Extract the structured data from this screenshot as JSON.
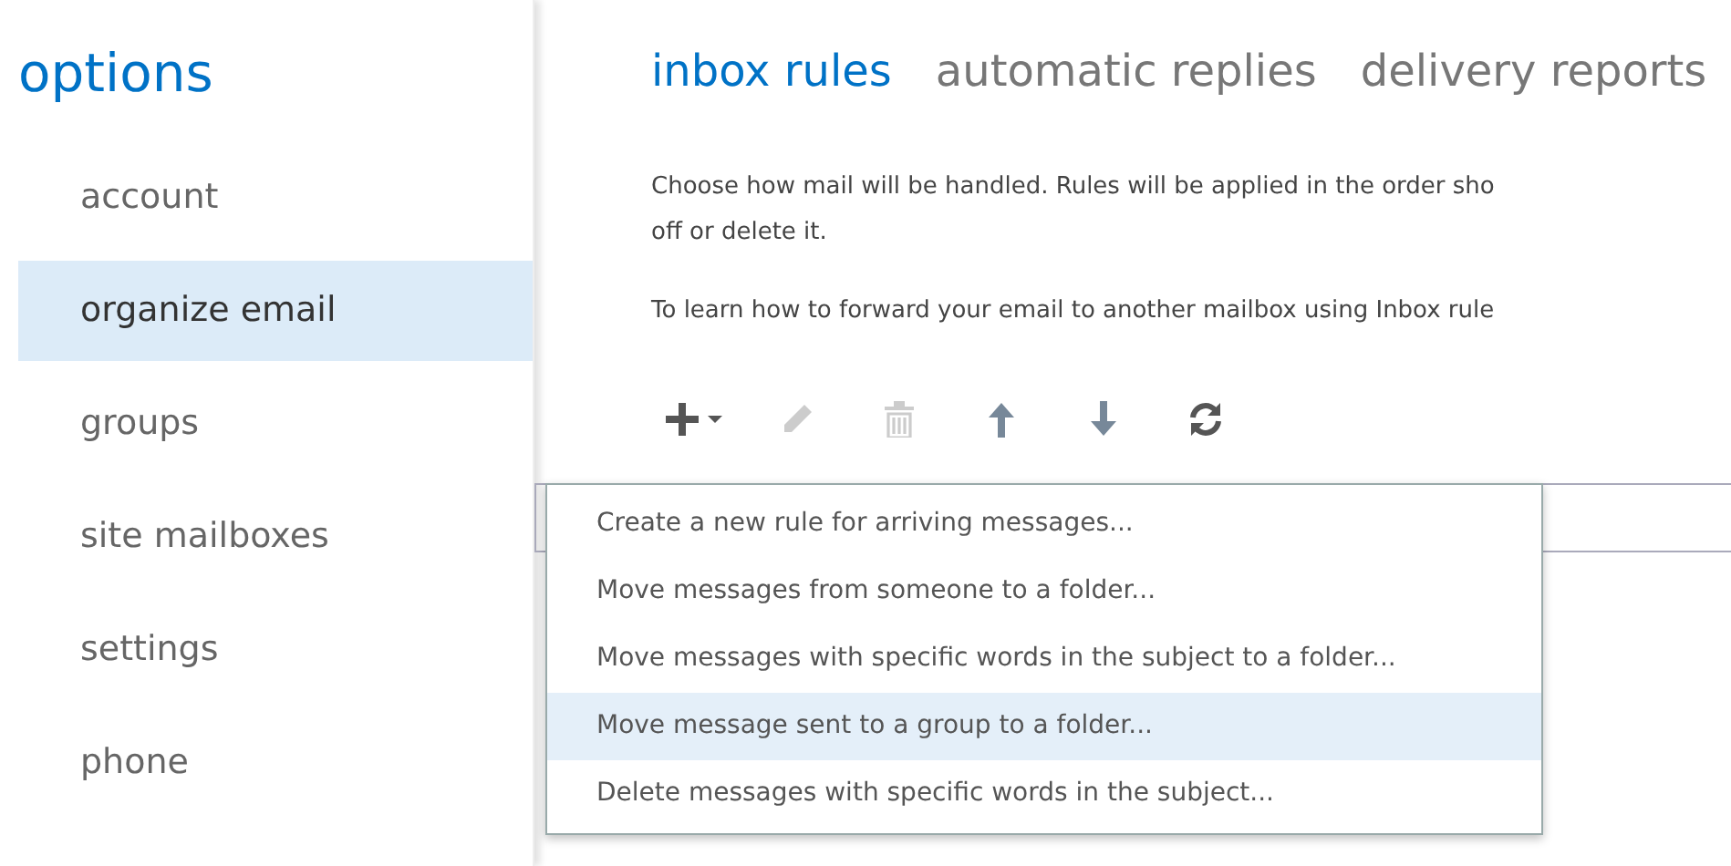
{
  "sidebar": {
    "title": "options",
    "items": [
      {
        "label": "account",
        "selected": false
      },
      {
        "label": "organize email",
        "selected": true
      },
      {
        "label": "groups",
        "selected": false
      },
      {
        "label": "site mailboxes",
        "selected": false
      },
      {
        "label": "settings",
        "selected": false
      },
      {
        "label": "phone",
        "selected": false
      }
    ]
  },
  "tabs": [
    {
      "label": "inbox rules",
      "selected": true
    },
    {
      "label": "automatic replies",
      "selected": false
    },
    {
      "label": "delivery reports",
      "selected": false
    }
  ],
  "description": [
    "Choose how mail will be handled. Rules will be applied in the order sho",
    "off or delete it."
  ],
  "forward_note": "To learn how to forward your email to another mailbox using Inbox rule",
  "toolbar": [
    {
      "kind": "add",
      "disabled": false
    },
    {
      "kind": "edit",
      "disabled": true
    },
    {
      "kind": "delete",
      "disabled": true
    },
    {
      "kind": "up",
      "disabled": false
    },
    {
      "kind": "down",
      "disabled": false
    },
    {
      "kind": "refresh",
      "disabled": false
    }
  ],
  "menu": [
    {
      "label": "Create a new rule for arriving messages...",
      "selected": false
    },
    {
      "label": "Move messages from someone to a folder...",
      "selected": false
    },
    {
      "label": "Move messages with specific words in the subject to a folder...",
      "selected": false
    },
    {
      "label": "Move message sent to a group to a folder...",
      "selected": true
    },
    {
      "label": "Delete messages with specific words in the subject...",
      "selected": false
    }
  ]
}
